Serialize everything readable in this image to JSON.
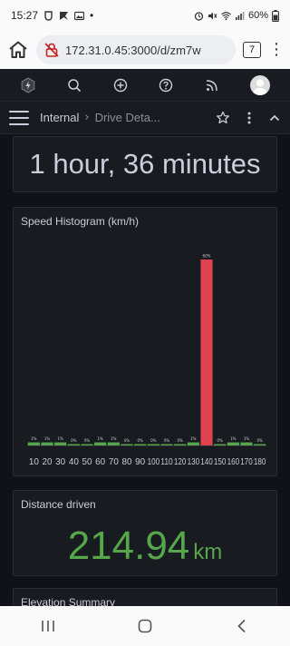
{
  "status_bar": {
    "time": "15:27",
    "battery": "60%",
    "dot": "•"
  },
  "browser": {
    "url": "172.31.0.45:3000/d/zm7w",
    "tab_count": "7",
    "more_icon": "⋮"
  },
  "breadcrumb": {
    "folder": "Internal",
    "separator": "›",
    "dashboard": "Drive Deta..."
  },
  "panels": {
    "duration": {
      "value": "1 hour, 36 minutes"
    },
    "speed_histogram": {
      "title": "Speed Histogram (km/h)"
    },
    "distance": {
      "title": "Distance driven",
      "value": "214.94",
      "unit": "km"
    },
    "elevation": {
      "title": "Elevation Summary"
    }
  },
  "chart_data": {
    "type": "bar",
    "title": "Speed Histogram (km/h)",
    "categories": [
      "10",
      "20",
      "30",
      "40",
      "50",
      "60",
      "70",
      "80",
      "90",
      "100",
      "110",
      "120",
      "130",
      "140",
      "150",
      "160",
      "170",
      "180"
    ],
    "values": [
      1,
      1,
      1,
      0,
      0,
      1,
      1,
      0,
      0,
      0,
      0,
      0,
      1,
      60,
      0,
      1,
      1,
      0
    ],
    "data_labels": [
      "1%",
      "1%",
      "1%",
      "0%",
      "0%",
      "1%",
      "1%",
      "0%",
      "0%",
      "0%",
      "0%",
      "0%",
      "1%",
      "60%",
      "0%",
      "1%",
      "1%",
      "0%"
    ],
    "ylim": [
      0,
      60
    ],
    "grid": false,
    "colors": {
      "normal": "#56a64b",
      "peak": "#e0414f",
      "label": "#ccccdc"
    }
  },
  "colors": {
    "background": "#111217",
    "panel": "#181b1f",
    "green": "#56a64b",
    "red": "#e0414f"
  }
}
